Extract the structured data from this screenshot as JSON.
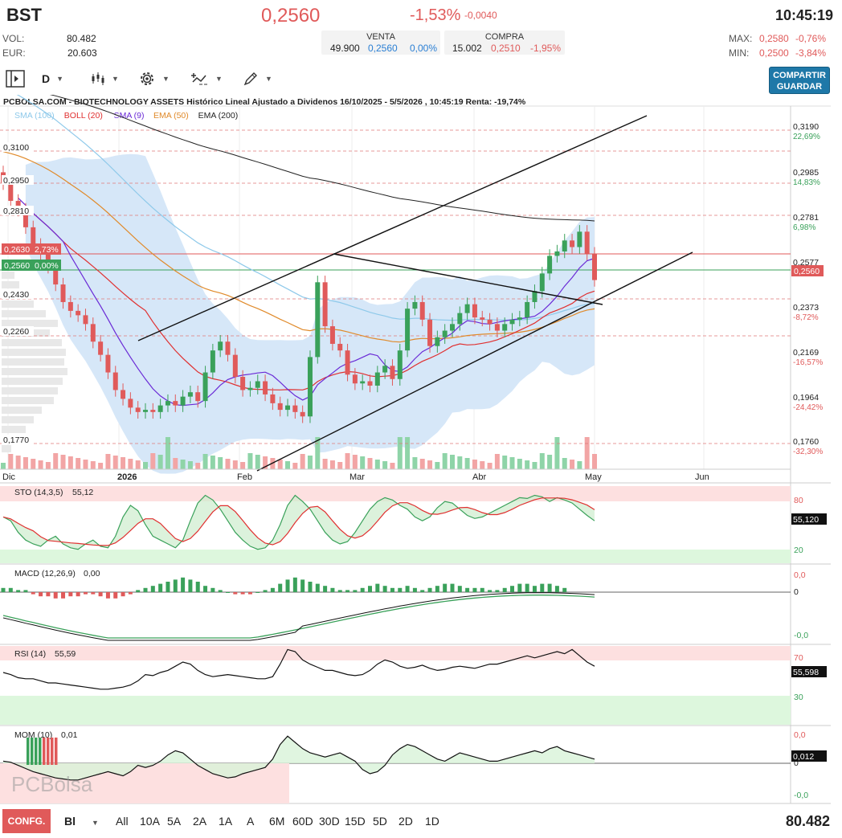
{
  "header": {
    "ticker": "BST",
    "price": "0,2560",
    "change_pct": "-1,53%",
    "change_abs": "-0,0040",
    "time": "10:45:19",
    "vol_label": "VOL:",
    "vol_value": "80.482",
    "eur_label": "EUR:",
    "eur_value": "20.603",
    "venta": {
      "label": "VENTA",
      "qty": "49.900",
      "price": "0,2560",
      "pct": "0,00%"
    },
    "compra": {
      "label": "COMPRA",
      "qty": "15.002",
      "price": "0,2510",
      "pct": "-1,95%"
    },
    "max_label": "MAX:",
    "max_value": "0,2580",
    "max_pct": "-0,76%",
    "min_label": "MIN:",
    "min_value": "0,2500",
    "min_pct": "-3,84%"
  },
  "toolbar": {
    "period": "D",
    "share_label_1": "COMPARTIR",
    "share_label_2": "GUARDAR",
    "icons": [
      "panel-toggle-icon",
      "candlestick-icon",
      "gear-icon",
      "indicator-icon",
      "drawing-pencil-icon"
    ]
  },
  "chart_title": "PCBOLSA.COM - BIOTECHNOLOGY ASSETS Histórico Lineal Ajustado a Dividenos 16/10/2025 - 5/5/2026 , 10:45:19 Renta: -19,74%",
  "legend": [
    {
      "label": "SMA (100)",
      "color": "#8ec9ea"
    },
    {
      "label": "BOLL (20)",
      "color": "#e03030"
    },
    {
      "label": "SMA (9)",
      "color": "#6a2ad6"
    },
    {
      "label": "EMA (50)",
      "color": "#e08a2a"
    },
    {
      "label": "EMA (200)",
      "color": "#222222"
    }
  ],
  "right_axis": [
    {
      "value": "0,3190",
      "pct": "22,69%",
      "sign": "pos"
    },
    {
      "value": "0,2985",
      "pct": "14,83%",
      "sign": "pos"
    },
    {
      "value": "0,2781",
      "pct": "6,98%",
      "sign": "pos"
    },
    {
      "value": "0,2577",
      "pct": "",
      "sign": "pos"
    },
    {
      "value": "0,2373",
      "pct": "-8,72%",
      "sign": "neg"
    },
    {
      "value": "0,2169",
      "pct": "-16,57%",
      "sign": "neg"
    },
    {
      "value": "0,1964",
      "pct": "-24,42%",
      "sign": "neg"
    },
    {
      "value": "0,1760",
      "pct": "-32,30%",
      "sign": "neg"
    }
  ],
  "left_levels": [
    "0,3100",
    "0,2950",
    "0,2810",
    "0,2430",
    "0,2260",
    "0,1770"
  ],
  "ref_prev": {
    "value": "0,2630",
    "pct": "2,73%"
  },
  "ref_last": {
    "value": "0,2560",
    "pct": "0,00%"
  },
  "last_price_tag": "0,2560",
  "x_labels": [
    "Dic",
    "2026",
    "Feb",
    "Mar",
    "Abr",
    "May",
    "Jun"
  ],
  "colors": {
    "up": "#3aa15a",
    "down": "#e05a5a",
    "accent": "#1e78a8"
  },
  "chart_data": {
    "type": "candlestick",
    "ylim": [
      0.17,
      0.34
    ],
    "series_daily_close": [
      0.3,
      0.292,
      0.288,
      0.28,
      0.272,
      0.268,
      0.262,
      0.254,
      0.246,
      0.242,
      0.24,
      0.236,
      0.228,
      0.222,
      0.214,
      0.206,
      0.202,
      0.198,
      0.196,
      0.197,
      0.196,
      0.199,
      0.201,
      0.199,
      0.203,
      0.205,
      0.201,
      0.214,
      0.224,
      0.228,
      0.222,
      0.212,
      0.206,
      0.207,
      0.21,
      0.204,
      0.2,
      0.197,
      0.199,
      0.196,
      0.194,
      0.221,
      0.255,
      0.235,
      0.227,
      0.224,
      0.213,
      0.209,
      0.21,
      0.208,
      0.214,
      0.217,
      0.211,
      0.224,
      0.243,
      0.246,
      0.238,
      0.226,
      0.23,
      0.233,
      0.236,
      0.241,
      0.245,
      0.239,
      0.238,
      0.236,
      0.233,
      0.236,
      0.238,
      0.239,
      0.246,
      0.251,
      0.259,
      0.267,
      0.269,
      0.274,
      0.271,
      0.278,
      0.268,
      0.256
    ]
  },
  "indicators": {
    "sto": {
      "label": "STO (14,3,5)",
      "value": "55,12",
      "tag": "55,120",
      "levels": [
        "80",
        "20"
      ]
    },
    "macd": {
      "label": "MACD (12,26,9)",
      "value": "0,00",
      "levels": [
        "0,0",
        "0",
        "-0,0"
      ]
    },
    "rsi": {
      "label": "RSI (14)",
      "value": "55,59",
      "tag": "55,598",
      "levels": [
        "70",
        "30"
      ]
    },
    "mom": {
      "label": "MOM (10)",
      "value": "0,01",
      "tag": "0,012",
      "levels": [
        "0,0",
        "0",
        "-0,0"
      ]
    }
  },
  "watermark": "PCBolsa",
  "bottombar": {
    "confg": "CONFG.",
    "interval": "Bl",
    "periods": [
      "All",
      "10A",
      "5A",
      "2A",
      "1A",
      "A",
      "6M",
      "60D",
      "30D",
      "15D",
      "5D",
      "2D",
      "1D"
    ],
    "total_volume": "80.482"
  }
}
